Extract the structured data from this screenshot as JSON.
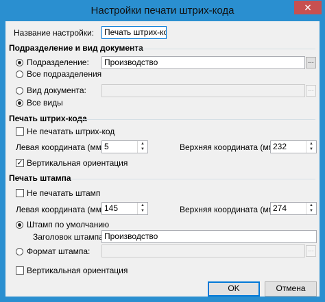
{
  "window": {
    "title": "Настройки печати штрих-кода",
    "close_glyph": "✕"
  },
  "settings_name": {
    "label": "Название настройки:",
    "value": "Печать штрих-кода"
  },
  "section_division": {
    "title": "Подразделение и вид документа",
    "division_radio_label": "Подразделение:",
    "division_value": "Производство",
    "all_divisions_label": "Все подразделения",
    "doc_type_label": "Вид документа:",
    "doc_type_value": "",
    "all_types_label": "Все виды",
    "ellipsis": "..."
  },
  "section_barcode": {
    "title": "Печать штрих-кода",
    "no_print_label": "Не печатать штрих-код",
    "no_print_checked": false,
    "left_label": "Левая координата (мм):",
    "left_value": "5",
    "top_label": "Верхняя координата (мм):",
    "top_value": "232",
    "vertical_label": "Вертикальная ориентация",
    "vertical_checked": true
  },
  "section_stamp": {
    "title": "Печать штампа",
    "no_print_label": "Не печатать штамп",
    "no_print_checked": false,
    "left_label": "Левая координата (мм):",
    "left_value": "145",
    "top_label": "Верхняя координата (мм):",
    "top_value": "274",
    "default_stamp_label": "Штамп по умолчанию",
    "header_label": "Заголовок штампа:",
    "header_value": "Производство",
    "format_label": "Формат штампа:",
    "format_value": "",
    "vertical_label": "Вертикальная ориентация",
    "vertical_checked": false
  },
  "buttons": {
    "ok": "OK",
    "cancel": "Отмена"
  },
  "icons": {
    "spin_up": "▲",
    "spin_down": "▼",
    "check": "✓"
  },
  "colors": {
    "titlebar": "#2a8fd0",
    "close_button": "#c75050",
    "client_bg": "#f0f0f0"
  }
}
